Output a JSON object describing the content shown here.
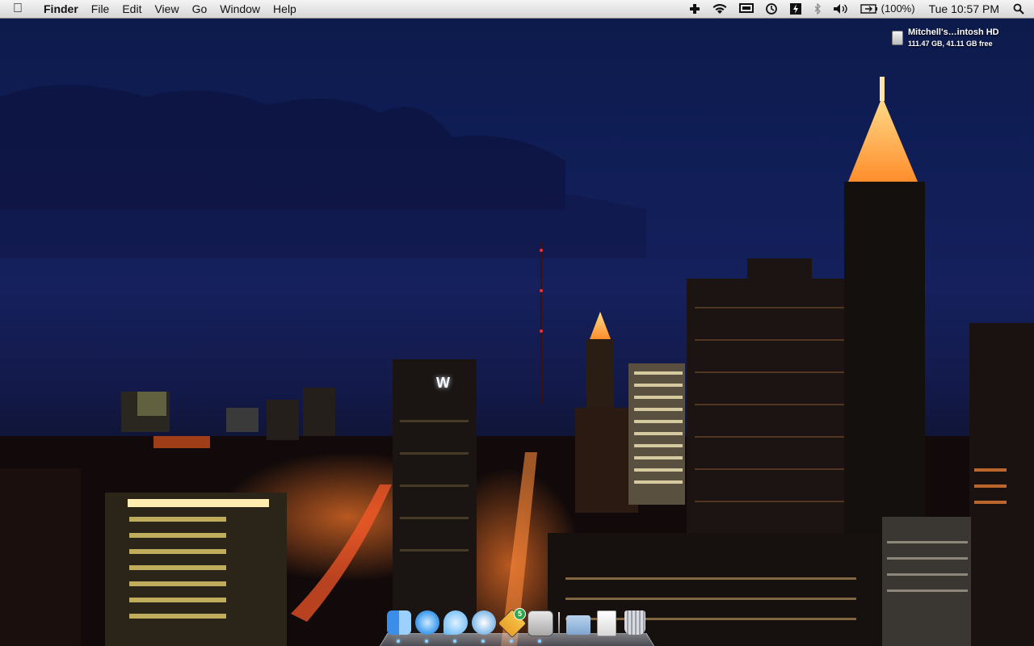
{
  "menubar": {
    "app_name": "Finder",
    "menus": [
      "File",
      "Edit",
      "View",
      "Go",
      "Window",
      "Help"
    ],
    "battery_percent": "(100%)",
    "clock": "Tue 10:57 PM"
  },
  "desktop": {
    "disk": {
      "name": "Mitchell's…intosh HD",
      "info": "111.47 GB, 41.11 GB free"
    },
    "building_sign": "W"
  },
  "dock": {
    "apps": [
      {
        "name": "finder-icon",
        "color": "#3b8ee8",
        "running": true
      },
      {
        "name": "safari-icon",
        "color": "#4aa3f0",
        "running": true
      },
      {
        "name": "ichat-icon",
        "color": "#5ab2f5",
        "running": true
      },
      {
        "name": "itunes-icon",
        "color": "#7fb8e8",
        "running": true
      },
      {
        "name": "transmission-icon",
        "color": "#e9a22a",
        "running": true,
        "badge": "5"
      },
      {
        "name": "system-preferences-icon",
        "color": "#c0c0c0",
        "running": true
      }
    ],
    "others": [
      {
        "name": "documents-folder-icon",
        "color": "#8fb5d9"
      },
      {
        "name": "music-file-icon",
        "color": "#e8e8e8"
      },
      {
        "name": "trash-icon",
        "color": "#b5b8bd"
      }
    ]
  }
}
